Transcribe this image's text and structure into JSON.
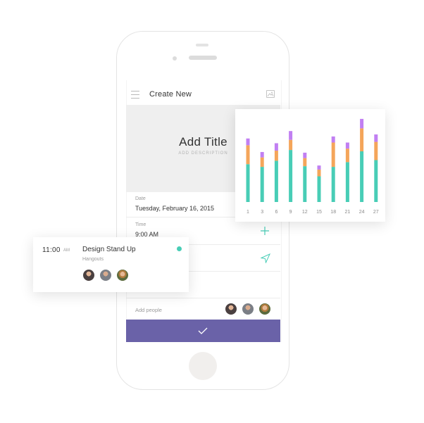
{
  "header": {
    "title": "Create New"
  },
  "title_area": {
    "title": "Add Title",
    "description": "ADD DESCRIPTION"
  },
  "date": {
    "label": "Date",
    "value": "Tuesday, February 16, 2015"
  },
  "time": {
    "label": "Time",
    "value": "9:00 AM"
  },
  "people": {
    "label": "Add people"
  },
  "event": {
    "time": "11:00",
    "ampm": "AM",
    "title": "Design Stand Up",
    "subtitle": "Hangouts"
  },
  "colors": {
    "accent": "#6a62a8",
    "teal": "#48cdb6",
    "orange": "#f4a55a",
    "purple": "#c17ff2"
  },
  "icons": [
    "menu-icon",
    "image-icon",
    "plus-icon",
    "send-icon",
    "check-icon"
  ],
  "chart_data": {
    "type": "bar",
    "stacked": true,
    "categories": [
      "1",
      "3",
      "6",
      "9",
      "12",
      "15",
      "18",
      "21",
      "24",
      "27"
    ],
    "series": [
      {
        "color": "#48cdb6",
        "values": [
          56,
          52,
          61,
          77,
          53,
          38,
          52,
          59,
          75,
          62
        ]
      },
      {
        "color": "#f4a55a",
        "values": [
          28,
          14,
          15,
          15,
          12,
          10,
          36,
          20,
          34,
          27
        ]
      },
      {
        "color": "#c17ff2",
        "values": [
          10,
          8,
          11,
          13,
          8,
          6,
          9,
          9,
          14,
          11
        ]
      }
    ],
    "ylim": [
      0,
      125
    ],
    "grid": false
  }
}
